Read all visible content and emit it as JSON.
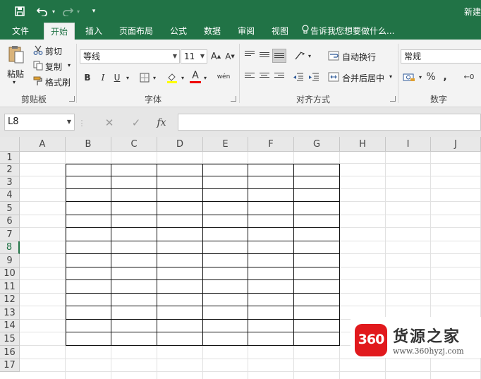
{
  "title_bar": {
    "doc_title": "新建",
    "save_icon": "save-icon",
    "undo_icon": "undo-icon",
    "redo_icon": "redo-icon",
    "customize_icon": "chevron-down-icon"
  },
  "tabs": [
    {
      "label": "文件",
      "active": false
    },
    {
      "label": "开始",
      "active": true
    },
    {
      "label": "插入",
      "active": false
    },
    {
      "label": "页面布局",
      "active": false
    },
    {
      "label": "公式",
      "active": false
    },
    {
      "label": "数据",
      "active": false
    },
    {
      "label": "审阅",
      "active": false
    },
    {
      "label": "视图",
      "active": false
    }
  ],
  "tell_me": "告诉我您想要做什么...",
  "ribbon": {
    "clipboard": {
      "paste": "粘贴",
      "cut": "剪切",
      "copy": "复制",
      "format_painter": "格式刷",
      "group": "剪贴板"
    },
    "font": {
      "font_name": "等线",
      "font_size": "11",
      "bold": "B",
      "italic": "I",
      "underline": "U",
      "grow": "A",
      "shrink": "A",
      "font_color": "A",
      "phonetic": "wén",
      "group": "字体"
    },
    "alignment": {
      "wrap_text": "自动换行",
      "merge_center": "合并后居中",
      "group": "对齐方式"
    },
    "number": {
      "format": "常规",
      "percent": "%",
      "comma": ",",
      "increase_decimal": "←0",
      "group": "数字"
    }
  },
  "formula_bar": {
    "name_box": "L8",
    "cancel": "✕",
    "enter": "✓",
    "function": "fx"
  },
  "sheet": {
    "columns": [
      "A",
      "B",
      "C",
      "D",
      "E",
      "F",
      "G",
      "H",
      "I",
      "J"
    ],
    "rows": [
      "1",
      "2",
      "3",
      "4",
      "5",
      "6",
      "7",
      "8",
      "9",
      "10",
      "11",
      "12",
      "13",
      "14",
      "15",
      "16",
      "17"
    ],
    "selected_row": "8"
  },
  "watermark": {
    "logo_text": "360",
    "name": "货源之家",
    "url": "www.360hyzj.com"
  },
  "colors": {
    "accent": "#217346",
    "watermark_red": "#e1191d"
  }
}
